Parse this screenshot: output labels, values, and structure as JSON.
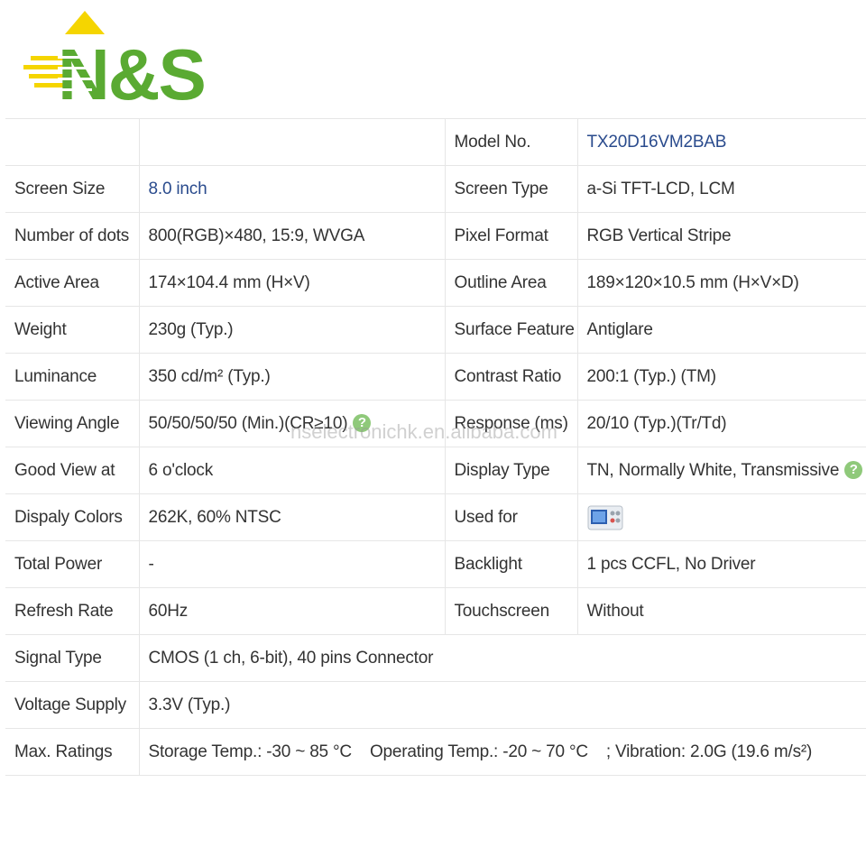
{
  "logo": {
    "text": "N&S",
    "primary_color": "#5aaa32",
    "accent_color": "#f5d500"
  },
  "watermark": "nselectronichk.en.alibaba.com",
  "colors": {
    "link_blue": "#2a4b8d",
    "help_icon_green": "#8fc97a",
    "border": "#e6e6e6"
  },
  "table": {
    "model_label": "Model No.",
    "model_value": "TX20D16VM2BAB",
    "rows": [
      {
        "l1": "Screen Size",
        "v1": "8.0 inch",
        "l2": "Screen Type",
        "v2": "a-Si TFT-LCD, LCM"
      },
      {
        "l1": "Number of dots",
        "v1": "800(RGB)×480, 15:9, WVGA",
        "l2": "Pixel Format",
        "v2": "RGB Vertical Stripe"
      },
      {
        "l1": "Active Area",
        "v1": "174×104.4 mm (H×V)",
        "l2": "Outline Area",
        "v2": "189×120×10.5 mm (H×V×D)"
      },
      {
        "l1": "Weight",
        "v1": "230g (Typ.)",
        "l2": "Surface Feature",
        "v2": "Antiglare"
      },
      {
        "l1": "Luminance",
        "v1": "350 cd/m² (Typ.)",
        "l2": "Contrast Ratio",
        "v2": "200:1 (Typ.) (TM)"
      },
      {
        "l1": "Viewing Angle",
        "v1": "50/50/50/50 (Min.)(CR≥10)",
        "l2": "Response (ms)",
        "v2": "20/10 (Typ.)(Tr/Td)"
      },
      {
        "l1": "Good View at",
        "v1": "6 o'clock",
        "l2": "Display Type",
        "v2": "TN, Normally White, Transmissive"
      },
      {
        "l1": "Dispaly Colors",
        "v1": "262K, 60% NTSC",
        "l2": "Used for",
        "v2_icon": "oscilloscope-icon"
      },
      {
        "l1": "Total Power",
        "v1": "-",
        "l2": "Backlight",
        "v2": "1 pcs CCFL, No Driver"
      },
      {
        "l1": "Refresh Rate",
        "v1": "60Hz",
        "l2": "Touchscreen",
        "v2": "Without"
      }
    ],
    "signal_type": {
      "label": "Signal Type",
      "value": "CMOS (1 ch, 6-bit), 40 pins Connector"
    },
    "voltage_supply": {
      "label": "Voltage Supply",
      "value": "3.3V (Typ.)"
    },
    "max_ratings": {
      "label": "Max. Ratings",
      "storage": "Storage Temp.: -30 ~ 85 °C",
      "operating": "Operating Temp.: -20 ~ 70 °C",
      "vibration": "; Vibration: 2.0G (19.6 m/s²)"
    },
    "help_glyph": "?"
  }
}
